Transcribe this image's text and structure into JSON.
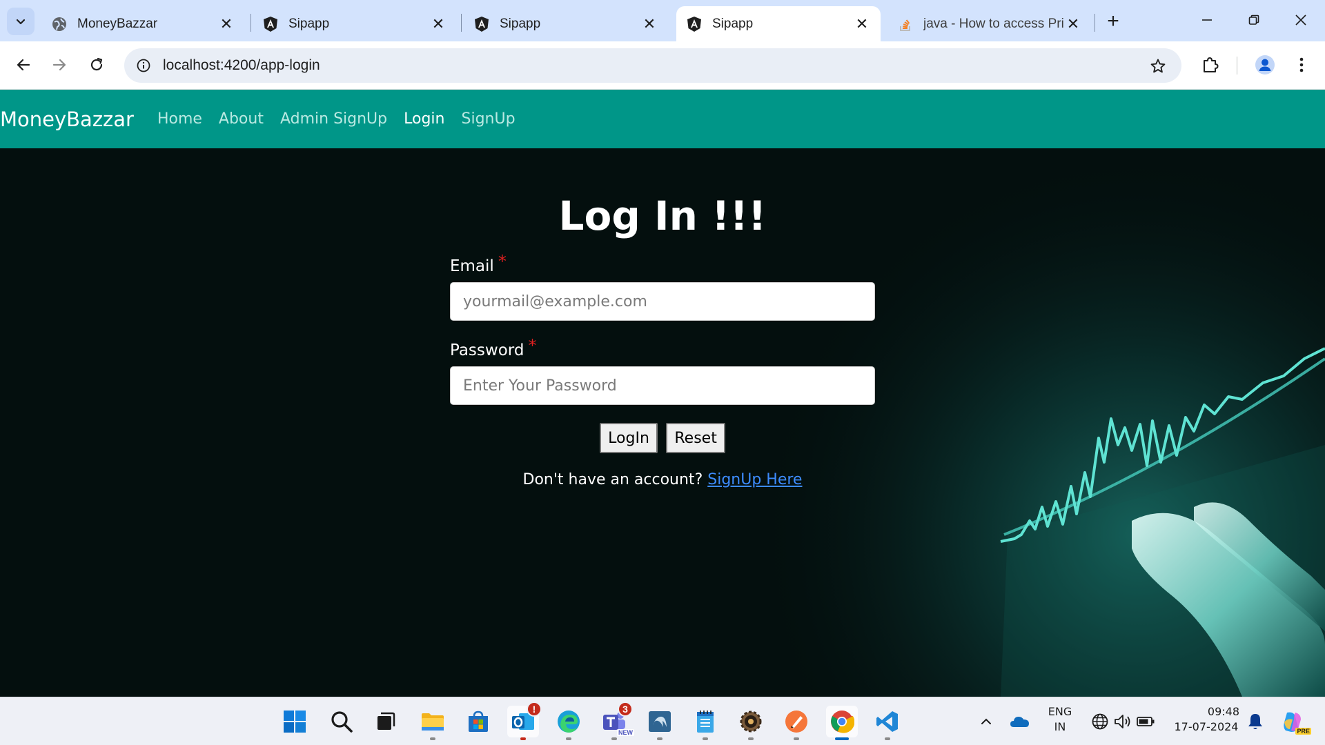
{
  "browser": {
    "tabs": [
      {
        "title": "MoneyBazzar",
        "icon": "globe-icon"
      },
      {
        "title": "Sipapp",
        "icon": "angular-icon"
      },
      {
        "title": "Sipapp",
        "icon": "angular-icon"
      },
      {
        "title": "Sipapp",
        "icon": "angular-icon",
        "active": true
      },
      {
        "title": "java - How to access Prin",
        "icon": "stackoverflow-icon"
      }
    ],
    "close_glyph": "✕",
    "new_tab_glyph": "+",
    "url": "localhost:4200/app-login"
  },
  "site": {
    "brand": "MoneyBazzar",
    "nav": [
      "Home",
      "About",
      "Admin SignUp",
      "Login",
      "SignUp"
    ],
    "active_nav": "Login",
    "accent_color": "#009688"
  },
  "login": {
    "heading": "Log In !!!",
    "email_label": "Email",
    "email_placeholder": "yourmail@example.com",
    "password_label": "Password",
    "password_placeholder": "Enter Your Password",
    "required_mark": "*",
    "login_button": "LogIn",
    "reset_button": "Reset",
    "signup_prompt": "Don't have an account?",
    "signup_link": "SignUp Here"
  },
  "taskbar": {
    "apps": [
      "windows-start-icon",
      "search-icon",
      "task-view-icon",
      "file-explorer-icon",
      "microsoft-store-icon",
      "outlook-icon",
      "edge-icon",
      "teams-icon",
      "mysql-workbench-icon",
      "notepad-icon",
      "settings-gear-icon",
      "paint-icon",
      "chrome-icon",
      "vscode-icon"
    ],
    "outlook_badge": "!",
    "teams_badge": "3",
    "teams_new": "NEW",
    "lang_top": "ENG",
    "lang_bottom": "IN",
    "time": "09:48",
    "date": "17-07-2024",
    "copilot_badge": "PRE"
  }
}
